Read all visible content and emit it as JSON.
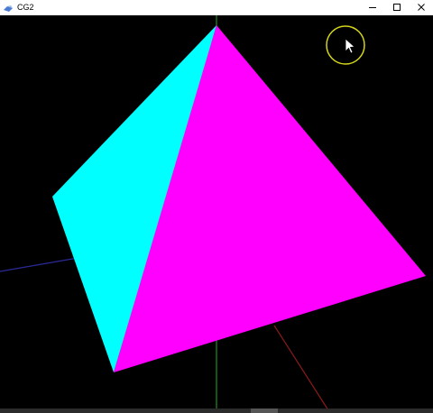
{
  "window": {
    "title": "CG2",
    "app_icon": "opengl-app-icon",
    "controls": [
      "minimize-icon",
      "maximize-icon",
      "close-icon"
    ]
  },
  "scene": {
    "background": "#000000",
    "faces": [
      {
        "name": "cyan-face",
        "color": "#00ffff"
      },
      {
        "name": "magenta-face",
        "color": "#ff00ff"
      }
    ],
    "axes": [
      {
        "name": "x-axis",
        "color": "#2a2a9a"
      },
      {
        "name": "y-axis",
        "color": "#1f8f1f"
      },
      {
        "name": "z-axis",
        "color": "#8a1a1a"
      }
    ],
    "cursor": {
      "icon": "mouse-pointer-icon",
      "highlight_color": "#d4d41a"
    }
  }
}
